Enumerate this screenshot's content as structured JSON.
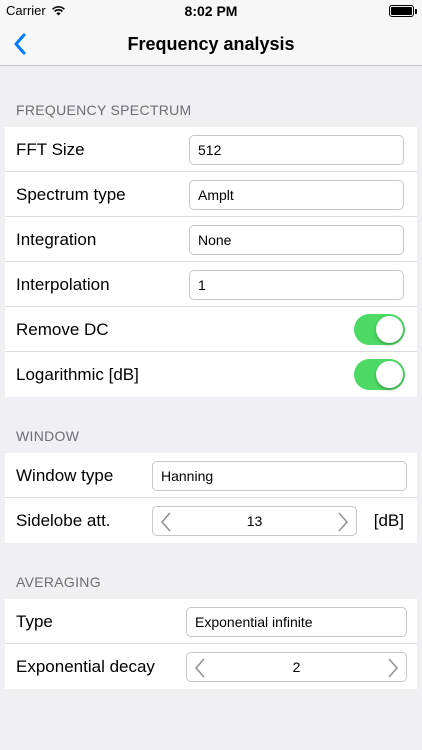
{
  "status": {
    "carrier": "Carrier",
    "time": "8:02 PM"
  },
  "nav": {
    "title": "Frequency analysis",
    "back_icon": "chevron-left-icon"
  },
  "sections": {
    "spectrum": {
      "header": "FREQUENCY SPECTRUM",
      "fft_label": "FFT Size",
      "fft_value": "512",
      "spectrum_type_label": "Spectrum type",
      "spectrum_type_value": "Amplt",
      "integration_label": "Integration",
      "integration_value": "None",
      "interpolation_label": "Interpolation",
      "interpolation_value": "1",
      "remove_dc_label": "Remove DC",
      "remove_dc_on": true,
      "log_label": "Logarithmic [dB]",
      "log_on": true
    },
    "window": {
      "header": "WINDOW",
      "type_label": "Window type",
      "type_value": "Hanning",
      "sidelobe_label": "Sidelobe att.",
      "sidelobe_value": "13",
      "sidelobe_unit": "[dB]"
    },
    "averaging": {
      "header": "AVERAGING",
      "type_label": "Type",
      "type_value": "Exponential infinite",
      "decay_label": "Exponential decay",
      "decay_value": "2"
    }
  },
  "colors": {
    "accent": "#007aff",
    "switch_on": "#4cd964",
    "background": "#efeff4"
  }
}
